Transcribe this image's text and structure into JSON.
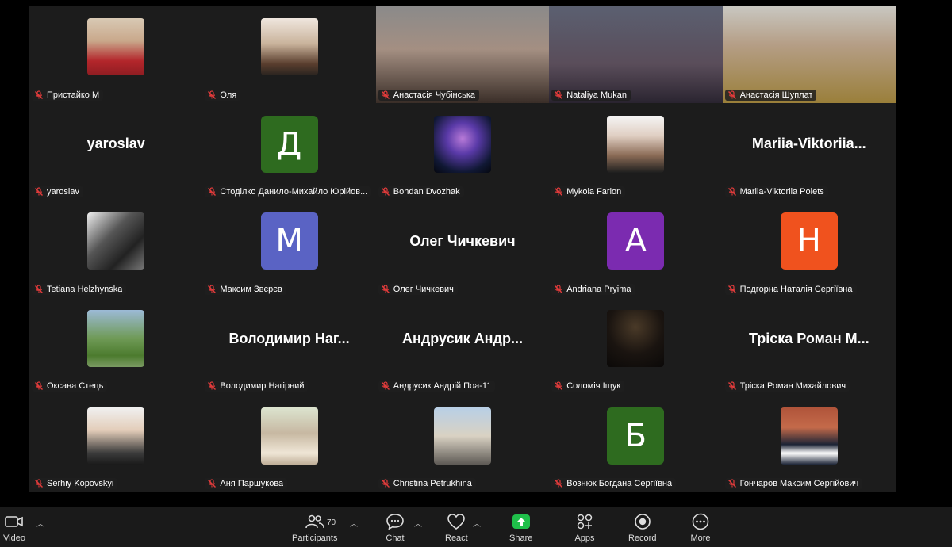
{
  "participants": [
    {
      "name": "Пристайко М",
      "kind": "photo",
      "muted": true
    },
    {
      "name": "Оля",
      "kind": "photo",
      "muted": true
    },
    {
      "name": "Анастасія Чубінська",
      "kind": "video",
      "muted": true
    },
    {
      "name": "Nataliya Mukan",
      "kind": "video",
      "muted": true
    },
    {
      "name": "Анастасія Шуплат",
      "kind": "video",
      "muted": true
    },
    {
      "name": "yaroslav",
      "kind": "text",
      "display": "yaroslav",
      "muted": true
    },
    {
      "name": "Стоділко Данило-Михайло Юрійов...",
      "kind": "avatar",
      "letter": "Д",
      "color": "#2e6b1f",
      "muted": true
    },
    {
      "name": "Bohdan Dvozhak",
      "kind": "photo",
      "muted": true
    },
    {
      "name": "Mykola Farion",
      "kind": "photo",
      "muted": true
    },
    {
      "name": "Mariia-Viktoriia Polets",
      "kind": "text",
      "display": "Mariia-Viktoriia...",
      "muted": true
    },
    {
      "name": "Tetiana Helzhynska",
      "kind": "photo",
      "muted": true
    },
    {
      "name": "Максим Звєрєв",
      "kind": "avatar",
      "letter": "M",
      "color": "#5a63c4",
      "muted": true
    },
    {
      "name": "Олег Чичкевич",
      "kind": "text",
      "display": "Олег Чичкевич",
      "muted": true
    },
    {
      "name": "Andriana Pryima",
      "kind": "avatar",
      "letter": "A",
      "color": "#7b2bb0",
      "muted": true
    },
    {
      "name": "Подгорна Наталія Сергіївна",
      "kind": "avatar",
      "letter": "Н",
      "color": "#f0521e",
      "muted": true
    },
    {
      "name": "Оксана Стець",
      "kind": "photo",
      "muted": true
    },
    {
      "name": "Володимир Нагірний",
      "kind": "text",
      "display": "Володимир Наг...",
      "muted": true
    },
    {
      "name": "Андрусик Андрій Поа-11",
      "kind": "text",
      "display": "Андрусик Андр...",
      "muted": true
    },
    {
      "name": "Соломія Іщук",
      "kind": "photo",
      "muted": true
    },
    {
      "name": "Тріска Роман Михайлович",
      "kind": "text",
      "display": "Тріска Роман М...",
      "muted": true
    },
    {
      "name": "Serhiy Kopovskyi",
      "kind": "photo",
      "muted": true
    },
    {
      "name": "Аня Паршукова",
      "kind": "photo",
      "muted": true
    },
    {
      "name": "Christina Petrukhina",
      "kind": "photo",
      "muted": true
    },
    {
      "name": "Вознюк Богдана Сергіївна",
      "kind": "avatar",
      "letter": "Б",
      "color": "#2e6b1f",
      "muted": true
    },
    {
      "name": "Гончаров Максим Сергійович",
      "kind": "photo",
      "muted": true
    }
  ],
  "toolbar": {
    "video_label": "Video",
    "participants_label": "Participants",
    "participants_count": "70",
    "chat_label": "Chat",
    "react_label": "React",
    "share_label": "Share",
    "apps_label": "Apps",
    "record_label": "Record",
    "more_label": "More",
    "share_color": "#1fbf4a"
  }
}
